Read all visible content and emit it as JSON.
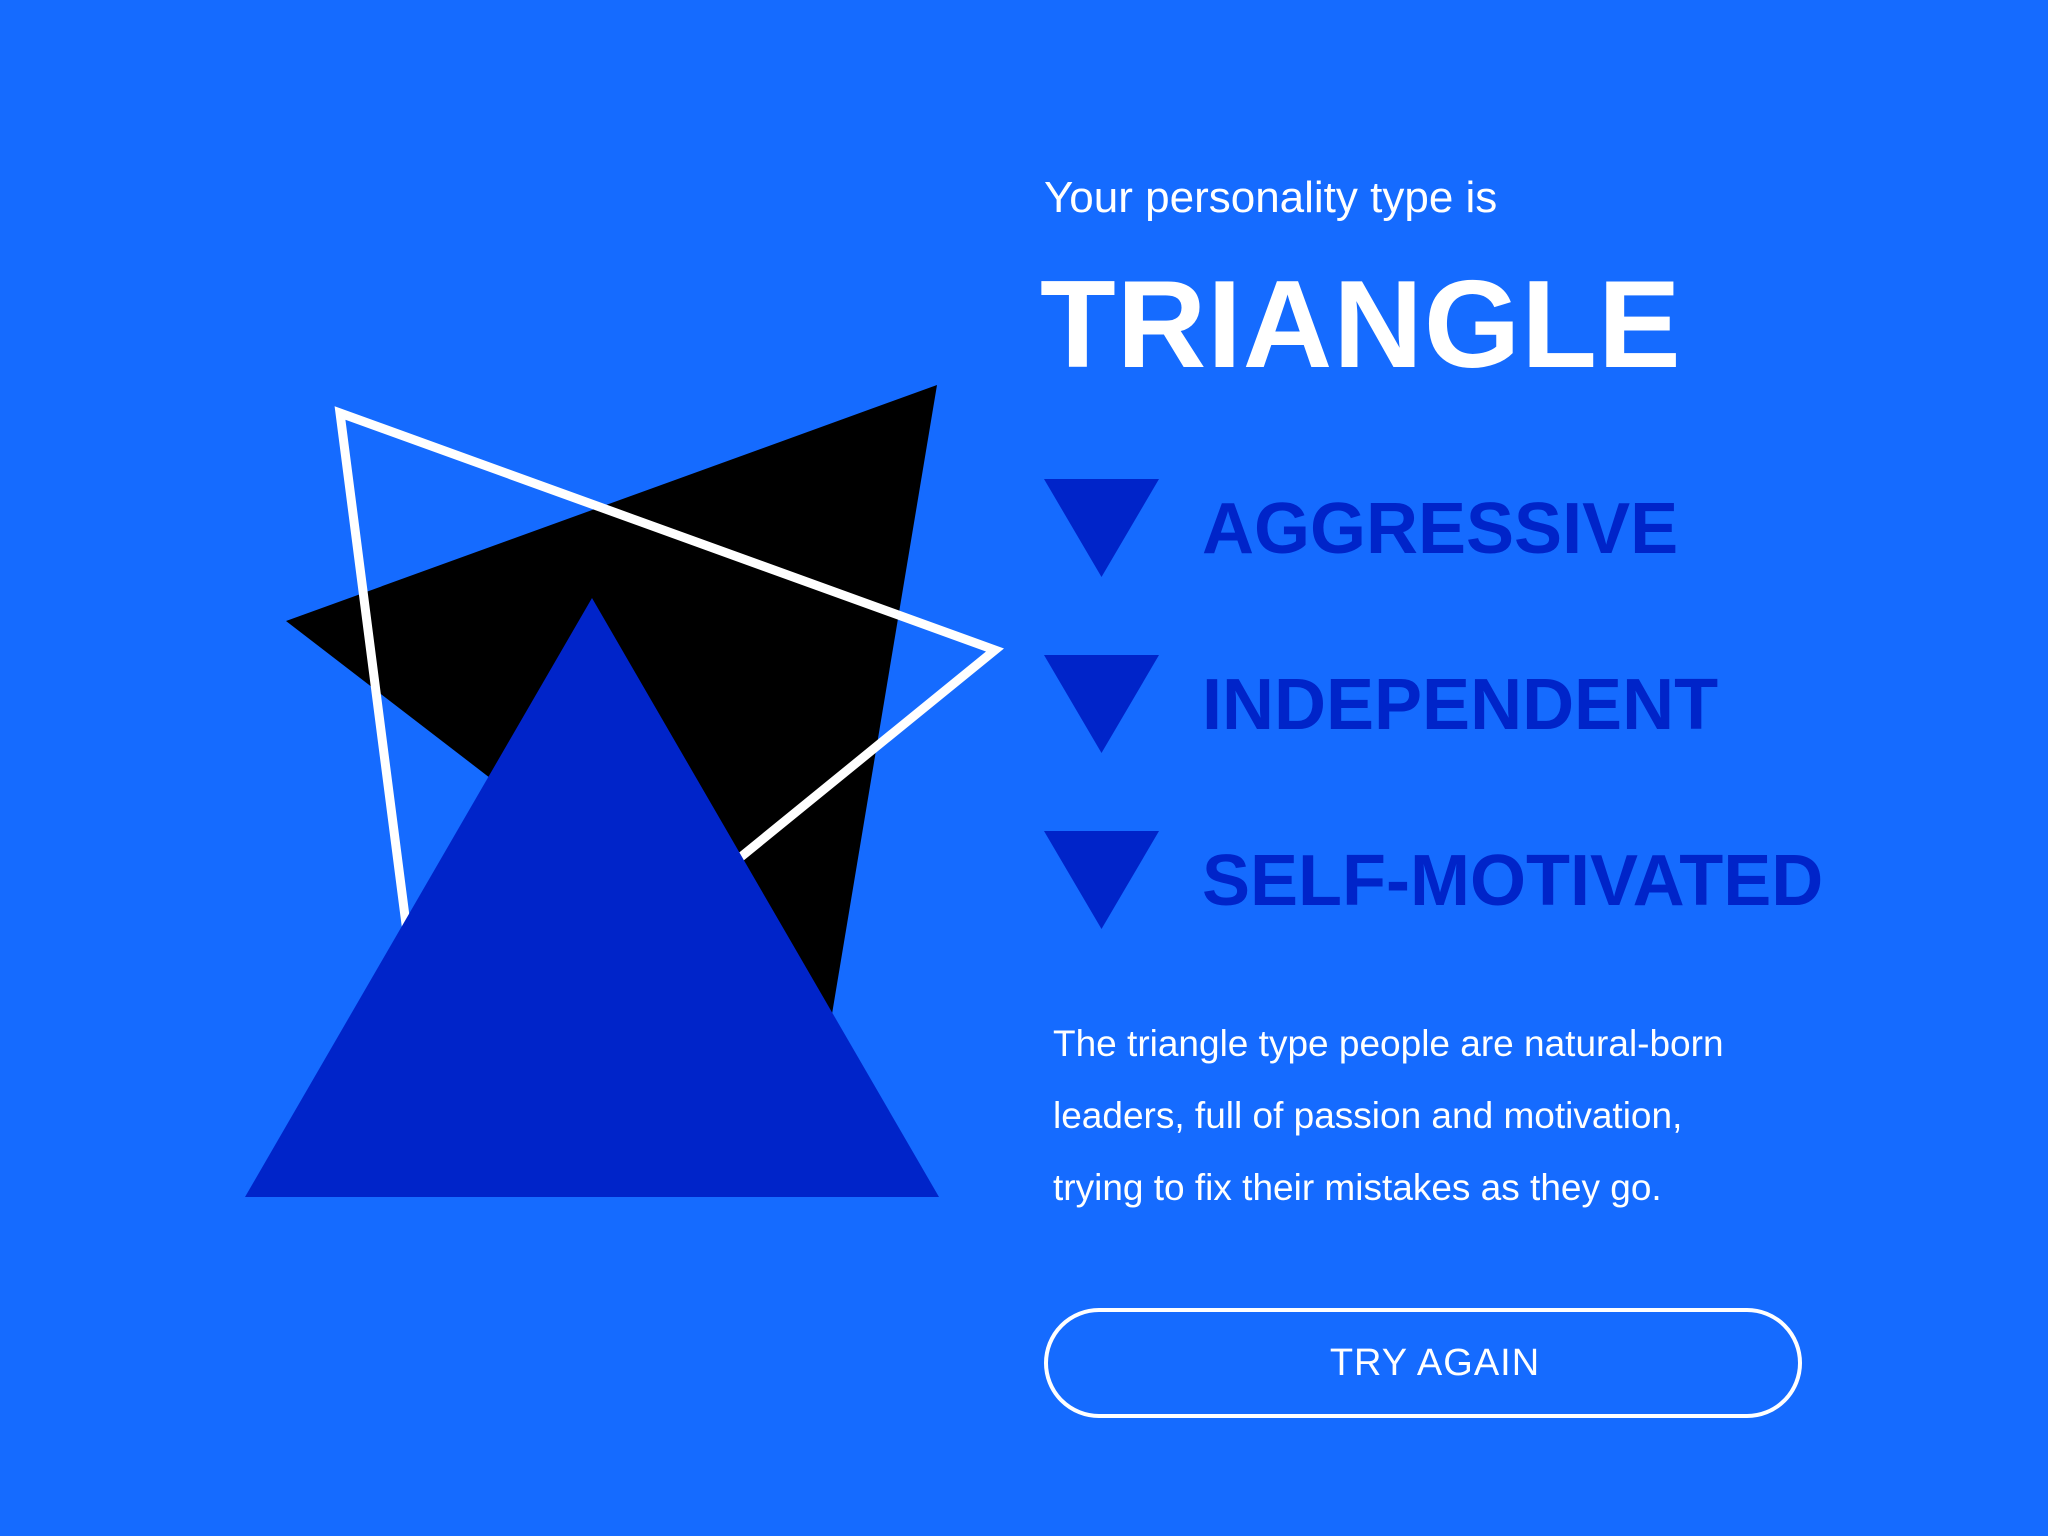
{
  "result": {
    "intro": "Your personality type is",
    "type_name": "TRIANGLE",
    "traits": [
      {
        "label": "AGGRESSIVE",
        "icon": "down-triangle-icon"
      },
      {
        "label": "INDEPENDENT",
        "icon": "down-triangle-icon"
      },
      {
        "label": "SELF-MOTIVATED",
        "icon": "down-triangle-icon"
      }
    ],
    "description_lines": [
      "The triangle type people are natural-born",
      "leaders, full of passion and motivation,",
      "trying to fix their mistakes as they go."
    ]
  },
  "actions": {
    "try_again_label": "TRY AGAIN"
  },
  "colors": {
    "background": "#156bff",
    "accent_dark_blue": "#0024c9",
    "black": "#000000",
    "white": "#ffffff"
  }
}
